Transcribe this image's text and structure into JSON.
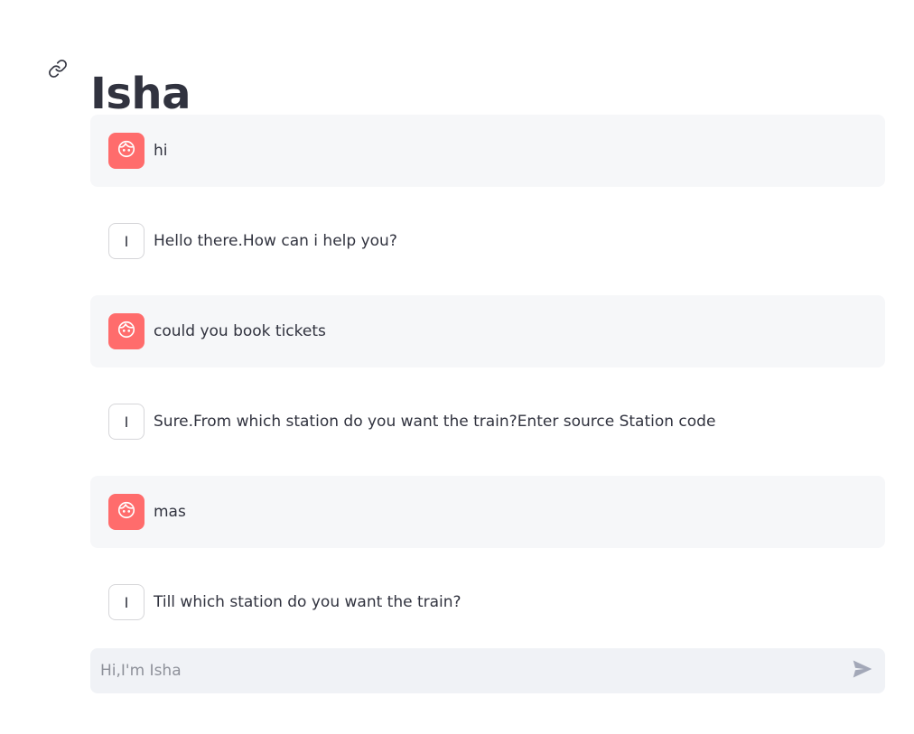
{
  "header": {
    "title": "Isha",
    "anchor_icon": "link-icon"
  },
  "messages": [
    {
      "role": "user",
      "avatar_icon": "face-icon",
      "text": "hi"
    },
    {
      "role": "assistant",
      "avatar_letter": "I",
      "text": "Hello there.How can i help you?"
    },
    {
      "role": "user",
      "avatar_icon": "face-icon",
      "text": "could you book tickets"
    },
    {
      "role": "assistant",
      "avatar_letter": "I",
      "text": "Sure.From which station do you want the train?Enter source Station code"
    },
    {
      "role": "user",
      "avatar_icon": "face-icon",
      "text": "mas"
    },
    {
      "role": "assistant",
      "avatar_letter": "I",
      "text": "Till which station do you want the train?"
    }
  ],
  "chat_input": {
    "placeholder": "Hi,I'm Isha",
    "value": "",
    "send_icon": "send-icon"
  },
  "colors": {
    "user_avatar_bg": "#ff6c6c",
    "user_message_bg": "#f6f7f9",
    "input_bg": "#f0f2f6",
    "text": "#31333f",
    "placeholder": "#8e919a"
  }
}
